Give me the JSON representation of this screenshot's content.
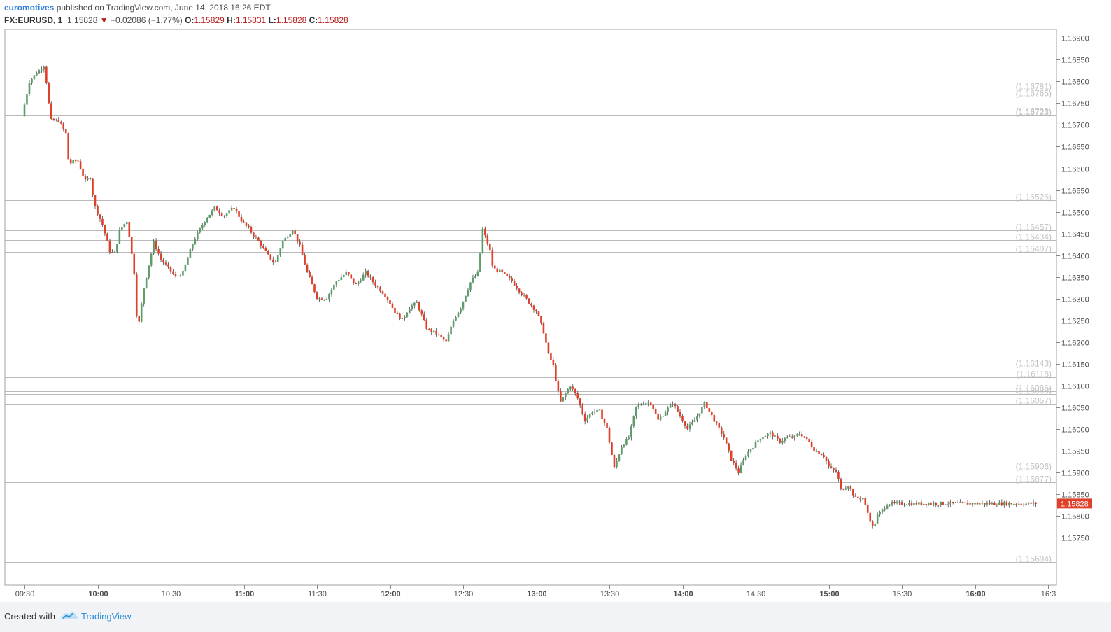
{
  "header": {
    "author": "euromotives",
    "published": "published on TradingView.com, June 14, 2018 16:26 EDT",
    "symbol": "FX:EURUSD, 1",
    "last": "1.15828",
    "change": "−0.02086 (−1.77%)",
    "o_label": "O:",
    "o_value": "1.15829",
    "h_label": "H:",
    "h_value": "1.15831",
    "l_label": "L:",
    "l_value": "1.15828",
    "c_label": "C:",
    "c_value": "1.15828"
  },
  "footer": {
    "created_with": "Created with",
    "brand": "TradingView"
  },
  "colors": {
    "up": "#5c9e6a",
    "down": "#e0402a",
    "grid": "#b9b9b9",
    "axis_text": "#4a4a4a",
    "level_text": "#c2c2c2",
    "price_tag": "#e0402a"
  },
  "chart_data": {
    "type": "candlestick",
    "ylim": [
      1.1564,
      1.1692
    ],
    "y_ticks": [
      "1.16900",
      "1.16850",
      "1.16800",
      "1.16750",
      "1.16700",
      "1.16650",
      "1.16600",
      "1.16550",
      "1.16500",
      "1.16450",
      "1.16400",
      "1.16350",
      "1.16300",
      "1.16250",
      "1.16200",
      "1.16150",
      "1.16100",
      "1.16050",
      "1.16000",
      "1.15950",
      "1.15900",
      "1.15850",
      "1.15800",
      "1.15750"
    ],
    "x_ticks": [
      {
        "label": "09:30",
        "t": 9.5,
        "bold": false
      },
      {
        "label": "10:00",
        "t": 10.0,
        "bold": true
      },
      {
        "label": "10:30",
        "t": 10.5,
        "bold": false
      },
      {
        "label": "11:00",
        "t": 11.0,
        "bold": true
      },
      {
        "label": "11:30",
        "t": 11.5,
        "bold": false
      },
      {
        "label": "12:00",
        "t": 12.0,
        "bold": true
      },
      {
        "label": "12:30",
        "t": 12.5,
        "bold": false
      },
      {
        "label": "13:00",
        "t": 13.0,
        "bold": true
      },
      {
        "label": "13:30",
        "t": 13.5,
        "bold": false
      },
      {
        "label": "14:00",
        "t": 14.0,
        "bold": true
      },
      {
        "label": "14:30",
        "t": 14.5,
        "bold": false
      },
      {
        "label": "15:00",
        "t": 15.0,
        "bold": true
      },
      {
        "label": "15:30",
        "t": 15.5,
        "bold": false
      },
      {
        "label": "16:00",
        "t": 16.0,
        "bold": true
      },
      {
        "label": "16:3",
        "t": 16.5,
        "bold": false
      }
    ],
    "levels": [
      {
        "price": 1.16781,
        "label": "(1.16781)"
      },
      {
        "price": 1.16765,
        "label": "(1.16765)"
      },
      {
        "price": 1.16723,
        "label": "(1.16723)"
      },
      {
        "price": 1.16721,
        "label": "(1.16721)"
      },
      {
        "price": 1.16526,
        "label": "(1.16526)"
      },
      {
        "price": 1.16457,
        "label": "(1.16457)"
      },
      {
        "price": 1.16434,
        "label": "(1.16434)"
      },
      {
        "price": 1.16407,
        "label": "(1.16407)"
      },
      {
        "price": 1.16143,
        "label": "(1.16143)"
      },
      {
        "price": 1.16118,
        "label": "(1.16118)"
      },
      {
        "price": 1.16086,
        "label": "(1.16086)"
      },
      {
        "price": 1.1608,
        "label": "(1.16080)"
      },
      {
        "price": 1.16057,
        "label": "(1.16057)"
      },
      {
        "price": 1.15906,
        "label": "(1.15906)"
      },
      {
        "price": 1.15877,
        "label": "(1.15877)"
      },
      {
        "price": 1.15694,
        "label": "(1.15694)"
      }
    ],
    "last_price": "1.15828",
    "start_time": 9.5,
    "end_time": 16.42,
    "path": [
      [
        9.5,
        1.1672
      ],
      [
        9.55,
        1.168
      ],
      [
        9.6,
        1.1682
      ],
      [
        9.66,
        1.1684
      ],
      [
        9.67,
        1.1678
      ],
      [
        9.7,
        1.1671
      ],
      [
        9.75,
        1.1671
      ],
      [
        9.8,
        1.1668
      ],
      [
        9.82,
        1.1661
      ],
      [
        9.88,
        1.1662
      ],
      [
        9.93,
        1.1657
      ],
      [
        9.97,
        1.1658
      ],
      [
        9.99,
        1.1652
      ],
      [
        10.05,
        1.1647
      ],
      [
        10.1,
        1.1641
      ],
      [
        10.13,
        1.164
      ],
      [
        10.17,
        1.1646
      ],
      [
        10.22,
        1.1648
      ],
      [
        10.27,
        1.1635
      ],
      [
        10.29,
        1.1622
      ],
      [
        10.33,
        1.1632
      ],
      [
        10.4,
        1.1643
      ],
      [
        10.45,
        1.1639
      ],
      [
        10.5,
        1.1637
      ],
      [
        10.55,
        1.1635
      ],
      [
        10.6,
        1.1636
      ],
      [
        10.67,
        1.1643
      ],
      [
        10.75,
        1.1648
      ],
      [
        10.82,
        1.1651
      ],
      [
        10.88,
        1.1649
      ],
      [
        10.95,
        1.1651
      ],
      [
        11.0,
        1.1648
      ],
      [
        11.05,
        1.1646
      ],
      [
        11.12,
        1.1643
      ],
      [
        11.18,
        1.164
      ],
      [
        11.23,
        1.1638
      ],
      [
        11.28,
        1.1643
      ],
      [
        11.35,
        1.1646
      ],
      [
        11.4,
        1.1642
      ],
      [
        11.45,
        1.1636
      ],
      [
        11.52,
        1.163
      ],
      [
        11.58,
        1.163
      ],
      [
        11.65,
        1.1634
      ],
      [
        11.72,
        1.1636
      ],
      [
        11.78,
        1.1633
      ],
      [
        11.85,
        1.1636
      ],
      [
        11.92,
        1.1633
      ],
      [
        11.98,
        1.1631
      ],
      [
        12.05,
        1.1627
      ],
      [
        12.1,
        1.1625
      ],
      [
        12.15,
        1.1628
      ],
      [
        12.2,
        1.1629
      ],
      [
        12.27,
        1.1623
      ],
      [
        12.33,
        1.1622
      ],
      [
        12.4,
        1.162
      ],
      [
        12.45,
        1.1625
      ],
      [
        12.5,
        1.1628
      ],
      [
        12.57,
        1.1634
      ],
      [
        12.62,
        1.1636
      ],
      [
        12.65,
        1.1646
      ],
      [
        12.7,
        1.1641
      ],
      [
        12.72,
        1.1637
      ],
      [
        12.78,
        1.1636
      ],
      [
        12.85,
        1.1634
      ],
      [
        12.92,
        1.1631
      ],
      [
        12.97,
        1.1629
      ],
      [
        13.02,
        1.1627
      ],
      [
        13.07,
        1.1622
      ],
      [
        13.1,
        1.1617
      ],
      [
        13.13,
        1.1615
      ],
      [
        13.18,
        1.1606
      ],
      [
        13.25,
        1.161
      ],
      [
        13.3,
        1.1607
      ],
      [
        13.35,
        1.1602
      ],
      [
        13.4,
        1.1604
      ],
      [
        13.45,
        1.1604
      ],
      [
        13.5,
        1.16
      ],
      [
        13.55,
        1.1591
      ],
      [
        13.6,
        1.1596
      ],
      [
        13.65,
        1.1598
      ],
      [
        13.7,
        1.1605
      ],
      [
        13.75,
        1.1606
      ],
      [
        13.8,
        1.1606
      ],
      [
        13.85,
        1.1602
      ],
      [
        13.9,
        1.1604
      ],
      [
        13.95,
        1.1606
      ],
      [
        14.0,
        1.1603
      ],
      [
        14.05,
        1.16
      ],
      [
        14.1,
        1.1602
      ],
      [
        14.17,
        1.1606
      ],
      [
        14.2,
        1.1604
      ],
      [
        14.25,
        1.1601
      ],
      [
        14.3,
        1.1598
      ],
      [
        14.35,
        1.1593
      ],
      [
        14.4,
        1.159
      ],
      [
        14.45,
        1.1594
      ],
      [
        14.5,
        1.1596
      ],
      [
        14.55,
        1.1598
      ],
      [
        14.62,
        1.1599
      ],
      [
        14.68,
        1.1597
      ],
      [
        14.73,
        1.1598
      ],
      [
        14.78,
        1.1598
      ],
      [
        14.82,
        1.1599
      ],
      [
        14.88,
        1.1597
      ],
      [
        14.92,
        1.1595
      ],
      [
        14.98,
        1.1594
      ],
      [
        15.02,
        1.1591
      ],
      [
        15.07,
        1.159
      ],
      [
        15.1,
        1.1586
      ],
      [
        15.15,
        1.1587
      ],
      [
        15.2,
        1.1584
      ],
      [
        15.25,
        1.1584
      ],
      [
        15.3,
        1.1579
      ],
      [
        15.32,
        1.1577
      ],
      [
        15.35,
        1.158
      ],
      [
        15.4,
        1.1582
      ],
      [
        15.42,
        1.15828
      ]
    ]
  }
}
